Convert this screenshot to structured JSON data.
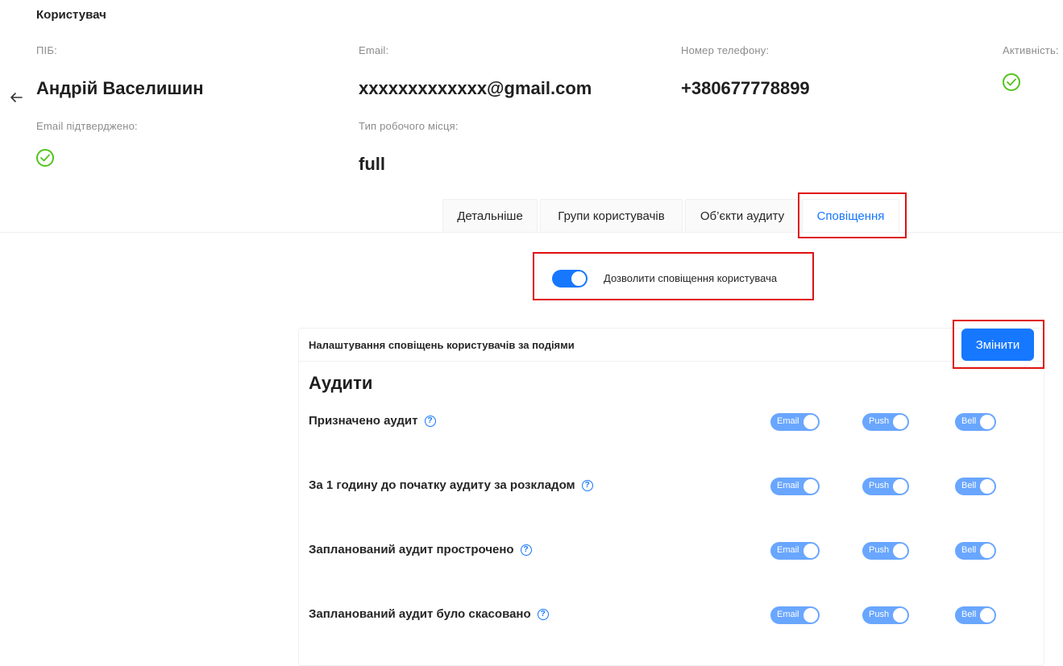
{
  "page": {
    "title": "Користувач"
  },
  "user": {
    "name_label": "ПІБ:",
    "name": "Андрій Васелишин",
    "email_label": "Email:",
    "email": "xxxxxxxxxxxxx@gmail.com",
    "phone_label": "Номер телефону:",
    "phone": "+380677778899",
    "active_label": "Активність:",
    "email_confirmed_label": "Email підтверджено:",
    "workplace_label": "Тип робочого місця:",
    "workplace": "full"
  },
  "tabs": [
    {
      "label": "Детальніше"
    },
    {
      "label": "Групи користувачів"
    },
    {
      "label": "Об’єкти аудиту"
    },
    {
      "label": "Сповіщення"
    }
  ],
  "notifications": {
    "allow_label": "Дозволити сповіщення користувача",
    "card_title": "Налаштування сповіщень користувачів за подіями",
    "edit_button": "Змінити",
    "section_title": "Аудити",
    "channels": [
      "Email",
      "Push",
      "Bell"
    ],
    "events": [
      {
        "label": "Призначено аудит"
      },
      {
        "label": "За 1 годину до початку аудиту за розкладом"
      },
      {
        "label": "Запланований аудит прострочено"
      },
      {
        "label": "Запланований аудит було скасовано"
      }
    ]
  },
  "colors": {
    "accent": "#1677ff",
    "success": "#52c41a",
    "highlight": "#e01010",
    "toggle_disabled": "#69a6ff"
  }
}
